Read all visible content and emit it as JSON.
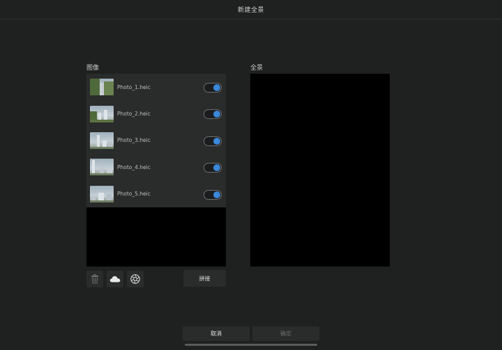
{
  "window": {
    "title": "新建全景"
  },
  "images_section": {
    "label": "图像"
  },
  "panorama_section": {
    "label": "全景"
  },
  "images": [
    {
      "name": "Photo_1.heic",
      "enabled": true
    },
    {
      "name": "Photo_2.heic",
      "enabled": true
    },
    {
      "name": "Photo_3.heic",
      "enabled": true
    },
    {
      "name": "Photo_4.heic",
      "enabled": true
    },
    {
      "name": "Photo_5.heic",
      "enabled": true
    }
  ],
  "toolbar": {
    "delete_icon": "trash-icon",
    "cloud_icon": "cloud-icon",
    "aperture_icon": "aperture-icon",
    "stitch_label": "拼接"
  },
  "footer": {
    "cancel_label": "取消",
    "ok_label": "确定"
  },
  "colors": {
    "background": "#1f2020",
    "panel": "#2a2b2b",
    "toggle_on": "#3b87d8",
    "disabled_text": "#6c6c6c"
  }
}
